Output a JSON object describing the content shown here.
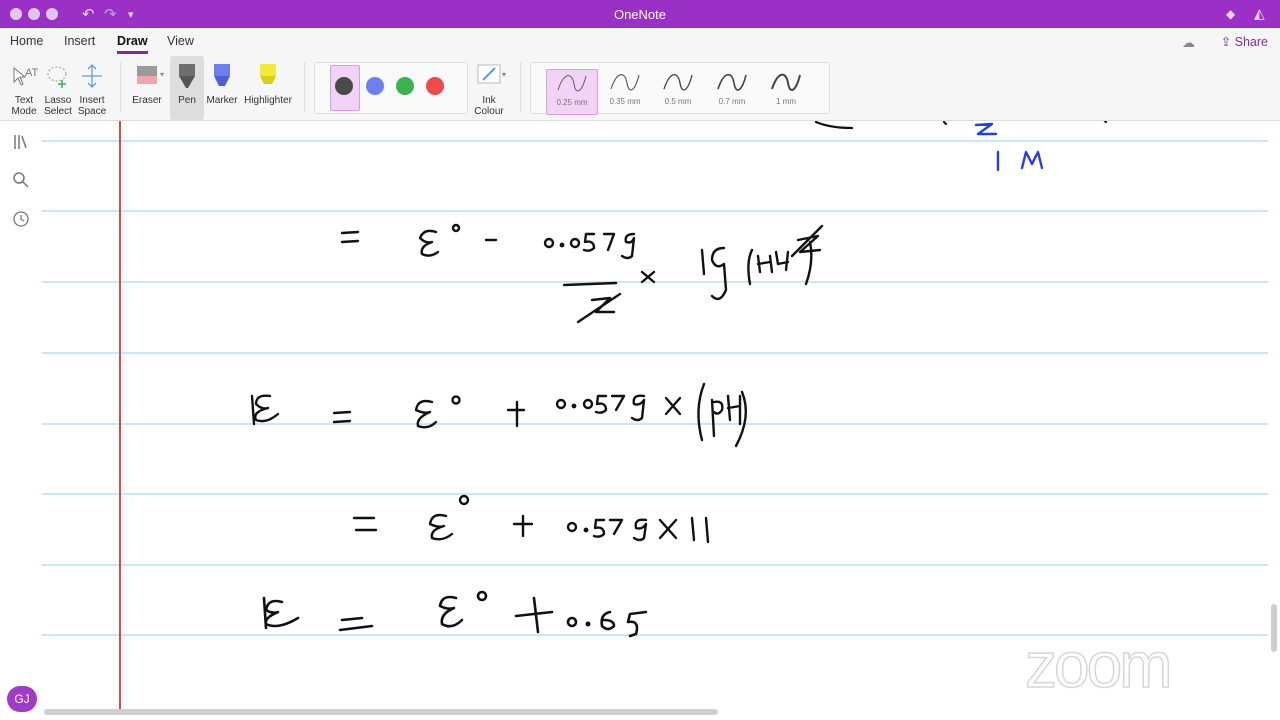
{
  "window": {
    "title": "OneNote"
  },
  "ribbon": {
    "tabs": [
      "Home",
      "Insert",
      "Draw",
      "View"
    ],
    "active_tab": "Draw",
    "share_label": "Share"
  },
  "toolbar": {
    "text_mode": [
      "Text",
      "Mode"
    ],
    "lasso_select": [
      "Lasso",
      "Select"
    ],
    "insert_space": [
      "Insert",
      "Space"
    ],
    "eraser": "Eraser",
    "pen": "Pen",
    "marker": "Marker",
    "highlighter": "Highlighter",
    "ink_colour": [
      "Ink",
      "Colour"
    ],
    "pen_colors": [
      "#4a4a4a",
      "#6e7ff0",
      "#3fb04f",
      "#ee4b4b"
    ],
    "thickness": [
      "0.25 mm",
      "0.35 mm",
      "0.5 mm",
      "0.7 mm",
      "1 mm"
    ],
    "selected_thickness": "0.25 mm"
  },
  "user": {
    "initials": "GJ"
  },
  "watermark": "zoom",
  "accent": "#9b30c7"
}
